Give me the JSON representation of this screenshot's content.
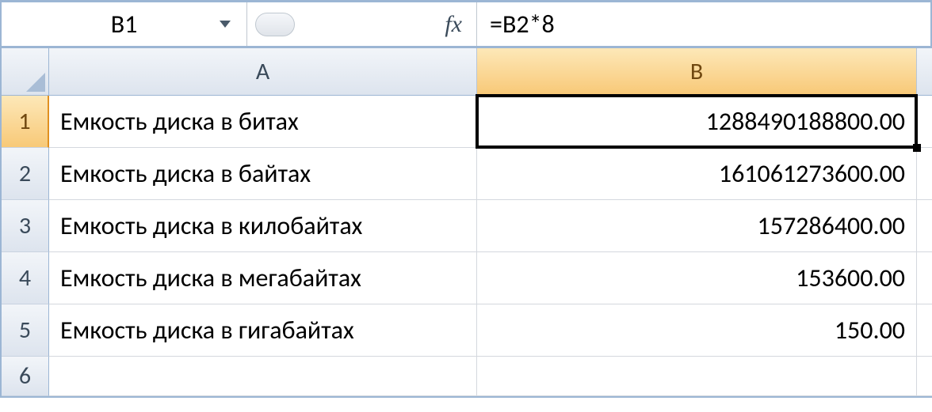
{
  "formula_bar": {
    "name_box": "B1",
    "fx_label": "fx",
    "formula": "=B2*8"
  },
  "columns": {
    "A": "A",
    "B": "B"
  },
  "rows": [
    "1",
    "2",
    "3",
    "4",
    "5",
    "6"
  ],
  "cells": {
    "A1": "Емкость диска в битах",
    "B1": "1288490188800.00",
    "A2": "Емкость диска в байтах",
    "B2": "161061273600.00",
    "A3": "Емкость диска в килобайтах",
    "B3": "157286400.00",
    "A4": "Емкость диска в мегабайтах",
    "B4": "153600.00",
    "A5": "Емкость диска в гигабайтах",
    "B5": "150.00",
    "A6": "",
    "B6": ""
  },
  "active_cell": "B1"
}
